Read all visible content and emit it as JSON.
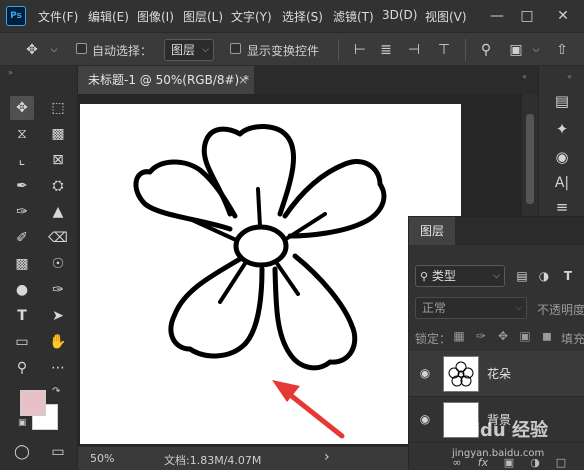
{
  "app": {
    "logo": "Ps"
  },
  "menu": {
    "items": [
      "文件(F)",
      "编辑(E)",
      "图像(I)",
      "图层(L)",
      "文字(Y)",
      "选择(S)",
      "滤镜(T)",
      "3D(D)",
      "视图(V)"
    ]
  },
  "window_controls": [
    "minimize-icon",
    "maximize-icon",
    "close-icon"
  ],
  "options_bar": {
    "auto_select_label": "自动选择：",
    "auto_select_value": "图层",
    "show_transform_label": "显示变换控件"
  },
  "document": {
    "tab_title": "未标题-1 @ 50%(RGB/8#) *",
    "tab_close": "×"
  },
  "status": {
    "zoom": "50%",
    "doc_info": "文档:1.83M/4.07M",
    "arrow": "›"
  },
  "layers_panel": {
    "tab_label": "图层",
    "filter_type": "类型",
    "blend_mode": "正常",
    "opacity_label": "不透明度",
    "lock_label": "锁定：",
    "fill_label": "填充",
    "layers": [
      {
        "name": "花朵",
        "visible": true
      },
      {
        "name": "背景",
        "visible": true
      }
    ]
  },
  "watermark": {
    "text": "Baidu 经验",
    "subtext": "jingyan.baidu.com"
  },
  "colors": {
    "foreground": "#e8c1c8",
    "background": "#ffffff",
    "annotation_arrow": "#e53935",
    "accent": "#31a8ff"
  }
}
